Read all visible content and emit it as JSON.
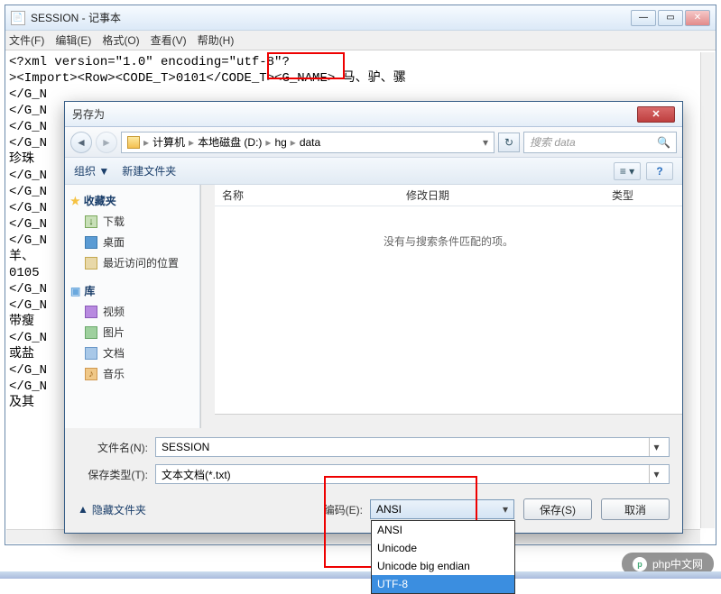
{
  "notepad": {
    "title": "SESSION - 记事本",
    "menus": [
      "文件(F)",
      "编辑(E)",
      "格式(O)",
      "查看(V)",
      "帮助(H)"
    ],
    "content": "<?xml version=\"1.0\" encoding=\"utf-8\"?\n><Import><Row><CODE_T>0101</CODE_T><G_NAME> 马、驴、骡\n</G_N\n</G_N\n</G_N\n</G_N\n珍珠\n</G_N\n</G_N\n</G_N\n</G_N\n</G_N\n羊、\n0105\n</G_N\n</G_N\n带瘦\n</G_N\n或盐\n</G_N\n</G_N\n及其",
    "highlight_encoding": "\"utf-8\"?"
  },
  "dialog": {
    "title": "另存为",
    "breadcrumb": [
      "计算机",
      "本地磁盘 (D:)",
      "hg",
      "data"
    ],
    "search_placeholder": "搜索 data",
    "toolbar": {
      "organize": "组织 ▼",
      "new_folder": "新建文件夹"
    },
    "sidebar": {
      "favorites": {
        "label": "收藏夹",
        "items": [
          "下载",
          "桌面",
          "最近访问的位置"
        ]
      },
      "libraries": {
        "label": "库",
        "items": [
          "视频",
          "图片",
          "文档",
          "音乐"
        ]
      }
    },
    "filelist": {
      "columns": [
        "名称",
        "修改日期",
        "类型"
      ],
      "empty_text": "没有与搜索条件匹配的项。"
    },
    "filename_label": "文件名(N):",
    "filename_value": "SESSION",
    "filetype_label": "保存类型(T):",
    "filetype_value": "文本文档(*.txt)",
    "hide_folders": "隐藏文件夹",
    "encoding_label": "编码(E):",
    "encoding_value": "ANSI",
    "encoding_options": [
      "ANSI",
      "Unicode",
      "Unicode big endian",
      "UTF-8"
    ],
    "encoding_highlighted": "UTF-8",
    "save_button": "保存(S)",
    "cancel_button": "取消"
  },
  "watermark": "php中文网"
}
